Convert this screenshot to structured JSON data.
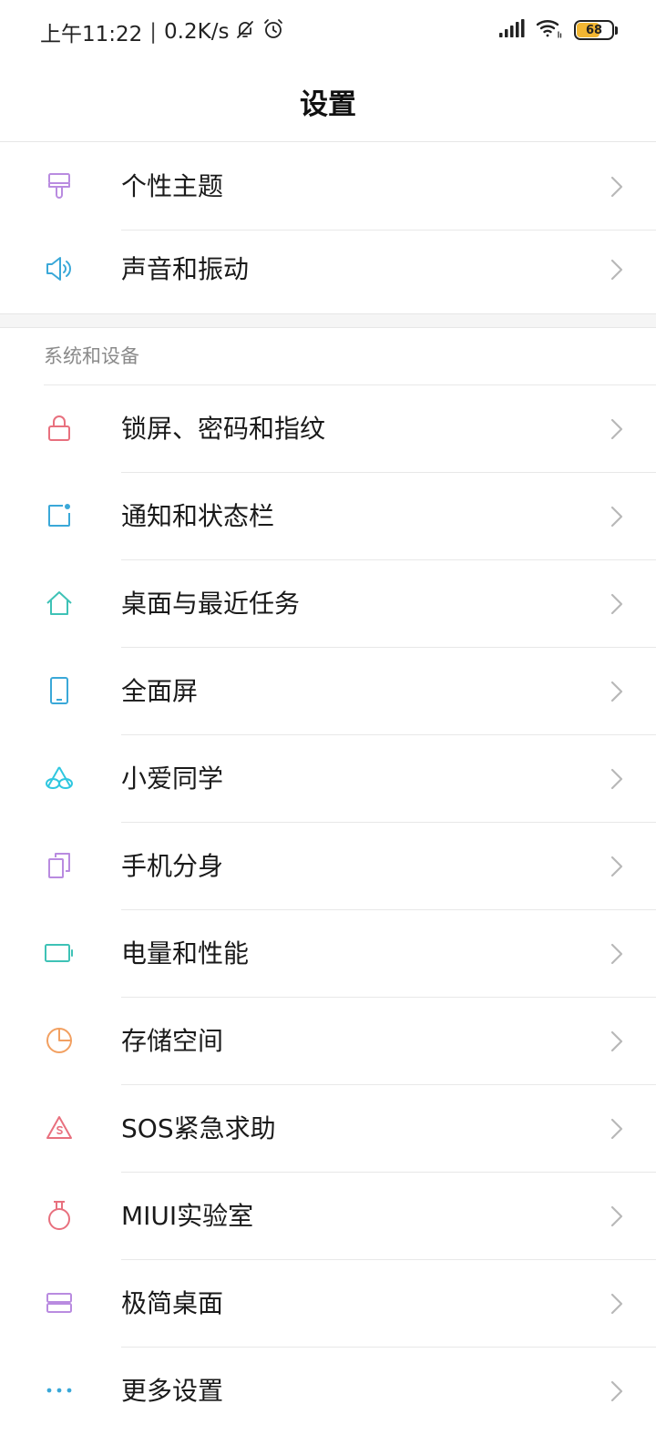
{
  "status_bar": {
    "time": "上午11:22",
    "separator": "|",
    "network_speed": "0.2K/s",
    "battery_level": "68",
    "battery_fraction": 0.68,
    "icons": [
      "mute-bell-icon",
      "alarm-clock-icon",
      "signal-icon",
      "wifi-icon",
      "battery-icon"
    ]
  },
  "header": {
    "title": "设置"
  },
  "group1": {
    "items": [
      {
        "label": "个性主题",
        "icon": "theme-brush-icon",
        "color": "#b98be0"
      },
      {
        "label": "声音和振动",
        "icon": "speaker-icon",
        "color": "#3aa8d8"
      }
    ]
  },
  "section": {
    "title": "系统和设备",
    "items": [
      {
        "label": "锁屏、密码和指纹",
        "icon": "lock-icon",
        "color": "#e8707e"
      },
      {
        "label": "通知和状态栏",
        "icon": "notification-icon",
        "color": "#3aa8d8"
      },
      {
        "label": "桌面与最近任务",
        "icon": "home-icon",
        "color": "#3ec2b6"
      },
      {
        "label": "全面屏",
        "icon": "phone-screen-icon",
        "color": "#3aa8d8"
      },
      {
        "label": "小爱同学",
        "icon": "xiaoai-icon",
        "color": "#2fc7e0"
      },
      {
        "label": "手机分身",
        "icon": "dual-phone-icon",
        "color": "#b98be0"
      },
      {
        "label": "电量和性能",
        "icon": "battery-outline-icon",
        "color": "#3ec2b6"
      },
      {
        "label": "存储空间",
        "icon": "pie-chart-icon",
        "color": "#f2a061"
      },
      {
        "label": "SOS紧急求助",
        "icon": "sos-warning-icon",
        "color": "#e8707e"
      },
      {
        "label": "MIUI实验室",
        "icon": "flask-icon",
        "color": "#e8707e"
      },
      {
        "label": "极简桌面",
        "icon": "simple-desktop-icon",
        "color": "#b98be0"
      },
      {
        "label": "更多设置",
        "icon": "more-dots-icon",
        "color": "#3aa8d8"
      }
    ]
  },
  "chevron_color": "#b8b8b8"
}
